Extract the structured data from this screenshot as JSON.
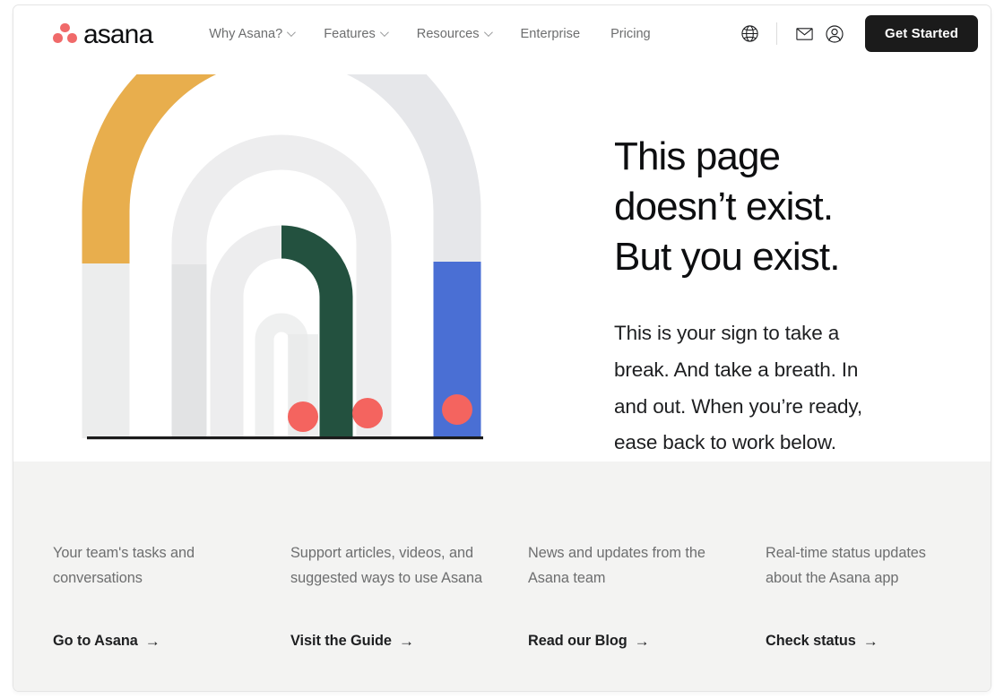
{
  "header": {
    "logo": {
      "wordmark": "asana",
      "dots_icon": "asana-three-dots-logo-icon",
      "dot_color": "#f06a6a"
    },
    "nav": [
      {
        "label": "Why Asana?",
        "has_caret": true
      },
      {
        "label": "Features",
        "has_caret": true
      },
      {
        "label": "Resources",
        "has_caret": true
      },
      {
        "label": "Enterprise",
        "has_caret": false
      },
      {
        "label": "Pricing",
        "has_caret": false
      }
    ],
    "icons": [
      {
        "name": "globe-icon",
        "title": "Language"
      },
      {
        "name": "mail-icon",
        "title": "Contact"
      },
      {
        "name": "account-icon",
        "title": "Account"
      }
    ],
    "cta_label": "Get Started",
    "cta_bg": "#1b1b1b"
  },
  "hero": {
    "title": "This page doesn’t exist. But you exist.",
    "body": "This is your sign to take a break. And take a breath. In and out. When you’re ready, ease back to work below.",
    "illustration": {
      "name": "nested-arches-illustration",
      "colors": {
        "amber": "#e8ae4d",
        "green": "#23513f",
        "blue": "#4a6fd4",
        "red_dot": "#f4645f",
        "gray_light": "#eceded",
        "gray_mid": "#e2e3e4",
        "gray_pale": "#f0f0f0",
        "baseline": "#1b1b1b"
      },
      "dot_count": 3
    }
  },
  "footer": {
    "bg": "#f3f3f2",
    "columns": [
      {
        "description": "Your team's tasks and conversations",
        "link_label": "Go to Asana",
        "arrow": "→"
      },
      {
        "description": "Support articles, videos, and suggested ways to use Asana",
        "link_label": "Visit the Guide",
        "arrow": "→"
      },
      {
        "description": "News and updates from the Asana team",
        "link_label": "Read our Blog",
        "arrow": "→"
      },
      {
        "description": "Real-time status updates about the Asana app",
        "link_label": "Check status",
        "arrow": "→"
      }
    ]
  }
}
